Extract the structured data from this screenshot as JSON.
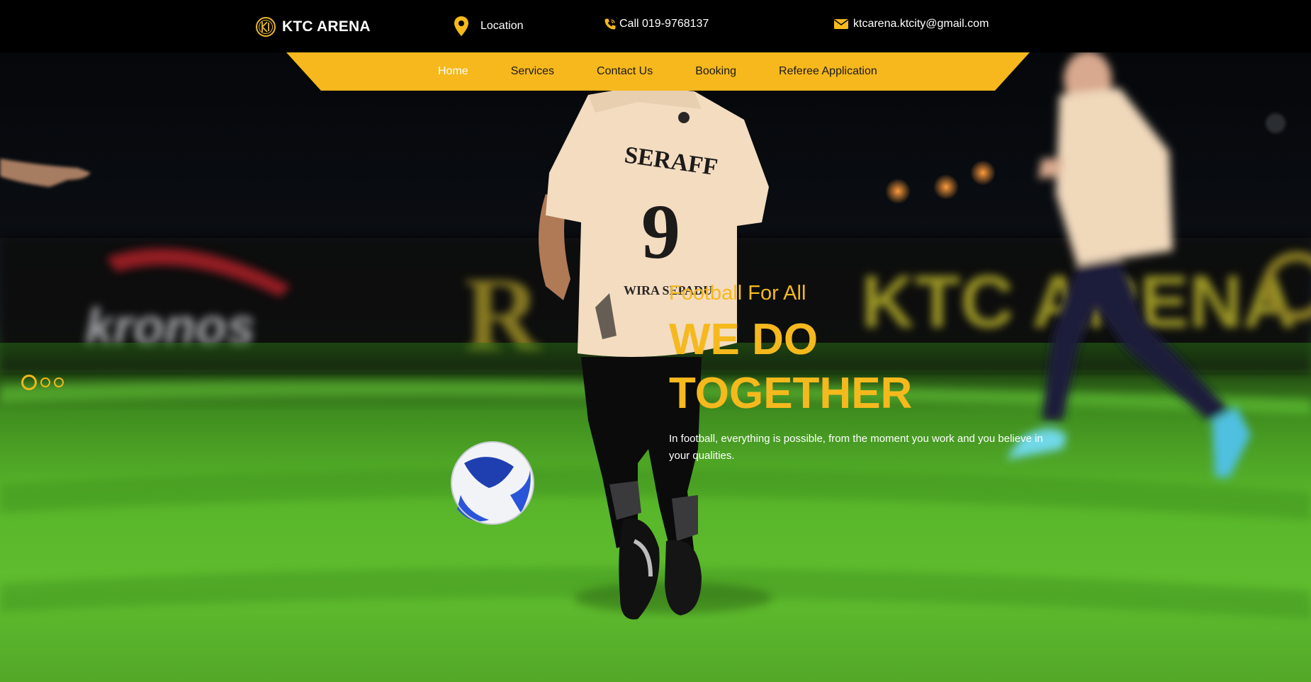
{
  "header": {
    "brand_name": "KTC ARENA",
    "location_label": "Location",
    "call_label": "Call 019-9768137",
    "email_label": "ktcarena.ktcity@gmail.com"
  },
  "nav": {
    "items": [
      {
        "label": "Home",
        "active": true
      },
      {
        "label": "Services",
        "active": false
      },
      {
        "label": "Contact Us",
        "active": false
      },
      {
        "label": "Booking",
        "active": false
      },
      {
        "label": "Referee Application",
        "active": false
      }
    ]
  },
  "hero": {
    "tagline": "Football For All",
    "headline": "WE DO TOGETHER",
    "description": "In football, everything is possible, from the moment you work and you believe in your qualities.",
    "slides_total": 3,
    "active_slide": 1,
    "background_banner_text": [
      "kronos",
      "R",
      "KTC ARENA"
    ],
    "player_shirt_text": [
      "SERAFF",
      "9",
      "WIRA SEPADU"
    ]
  },
  "colors": {
    "accent": "#f5b91d",
    "nav_bar": "#f6b81c",
    "top_bar": "#000000",
    "pitch": "#58b52a"
  },
  "icons": {
    "brand": "ktc-logo-icon",
    "location": "map-pin-icon",
    "call": "phone-icon",
    "email": "envelope-icon"
  }
}
